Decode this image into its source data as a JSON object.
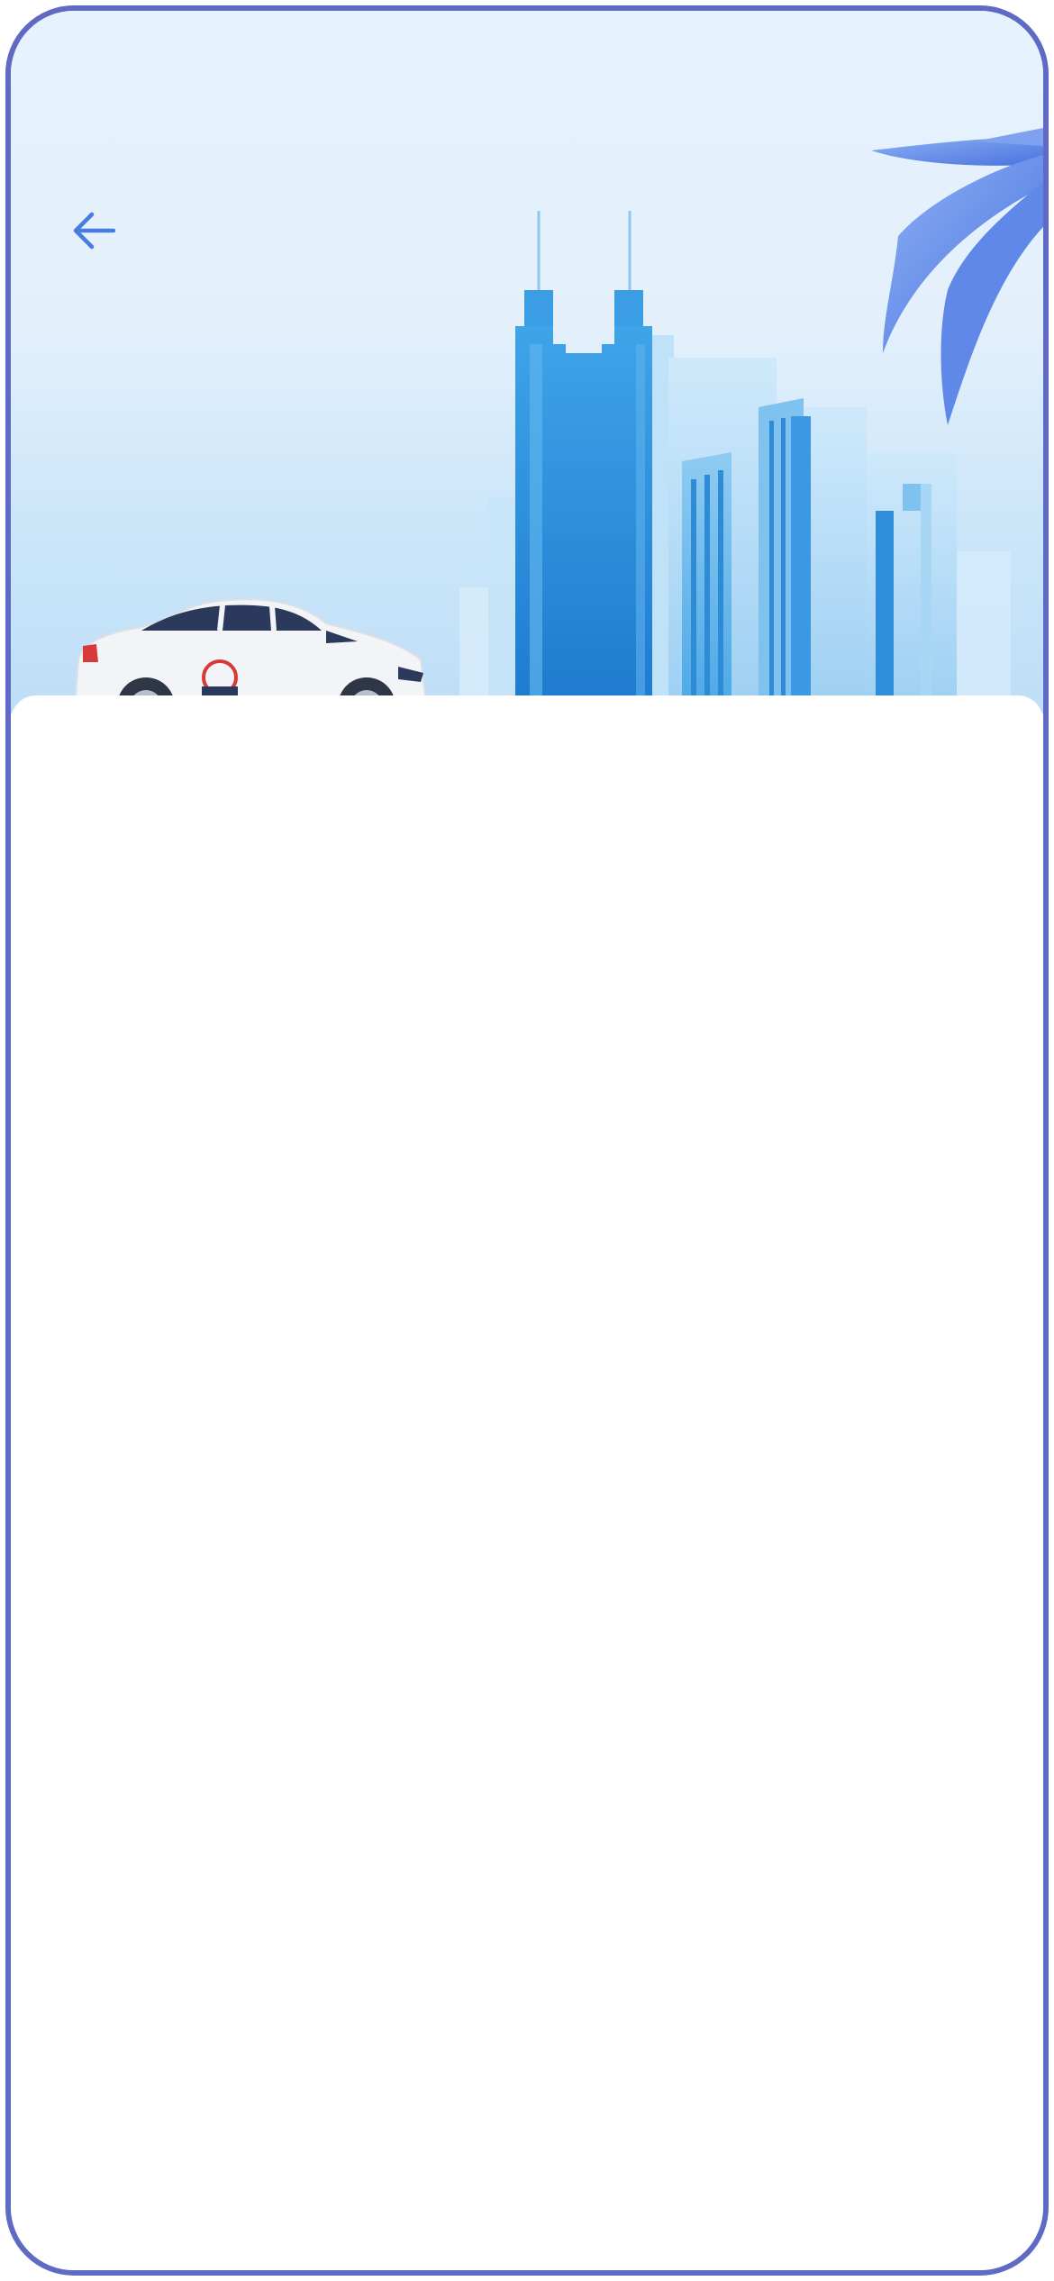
{
  "screen": {
    "name": "ride-hailing-landing"
  },
  "header": {
    "back_icon": "arrow-left-icon",
    "back_icon_color": "#4A7BE0"
  },
  "hero": {
    "illustration": "city-skyline-with-taxi",
    "sky_color": "#E6F2FD",
    "building_primary_color": "#2F8FDB",
    "building_light_color": "#A9D6F5",
    "palm_leaf_color": "#5A86E6",
    "car_body_color": "#F3F4F7"
  },
  "frame": {
    "border_color": "#5E6AC4"
  }
}
